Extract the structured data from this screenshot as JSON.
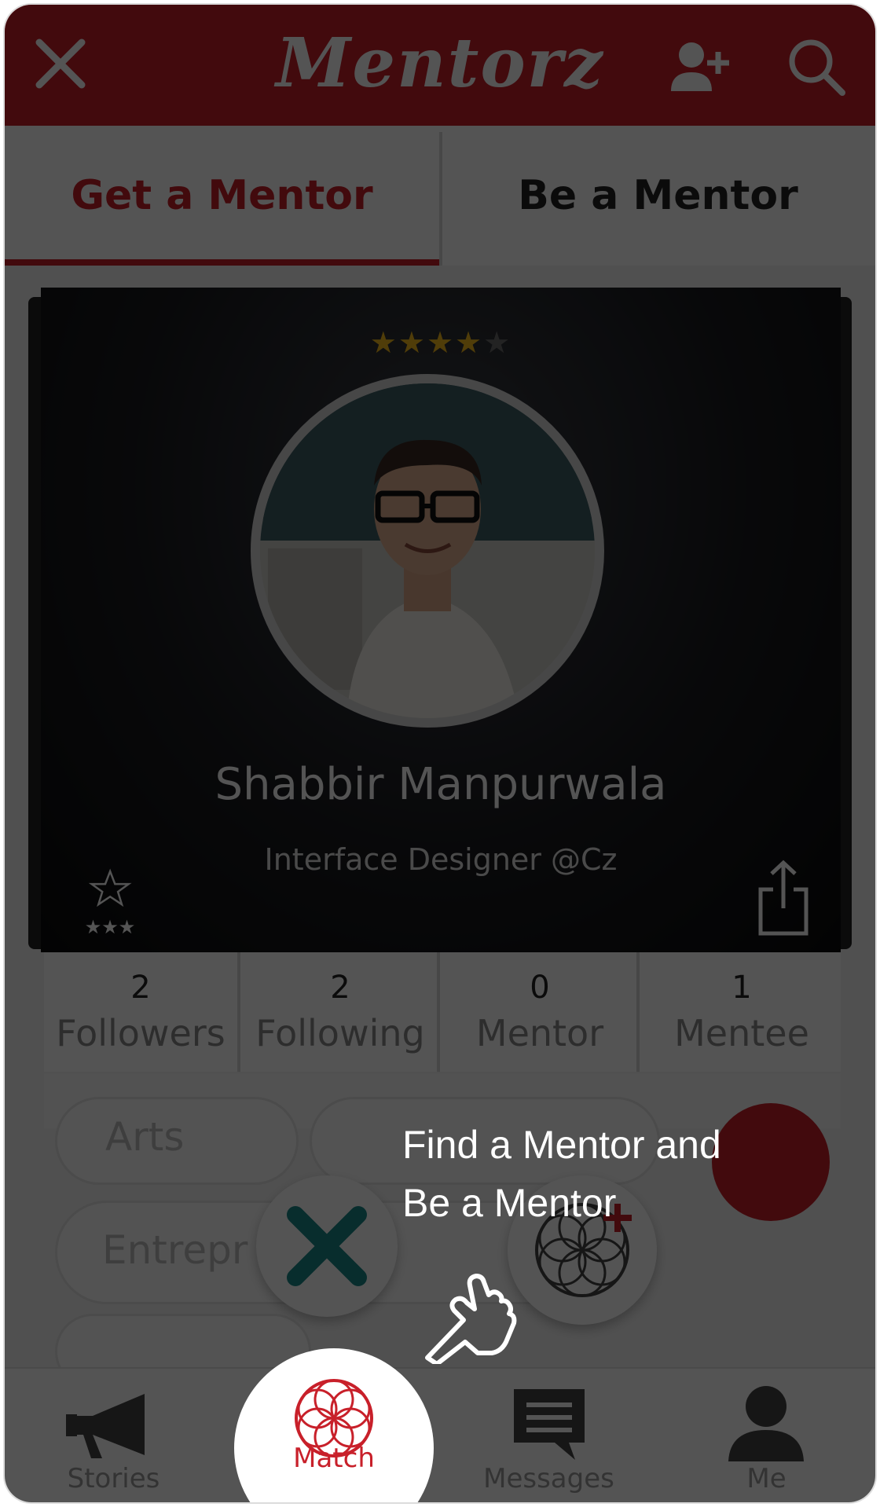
{
  "header": {
    "logo_text": "Mentorz",
    "close_icon": "close-icon",
    "add_user_icon": "add-user-icon",
    "search_icon": "search-icon"
  },
  "tabs": [
    {
      "label": "Get a Mentor",
      "active": true
    },
    {
      "label": "Be a Mentor",
      "active": false
    }
  ],
  "profile_card": {
    "rating": {
      "filled": 4,
      "total": 5
    },
    "name": "Shabbir Manpurwala",
    "title": "Interface Designer @Cz",
    "stats": [
      {
        "count": "2",
        "label": "Followers"
      },
      {
        "count": "2",
        "label": "Following"
      },
      {
        "count": "0",
        "label": "Mentor"
      },
      {
        "count": "1",
        "label": "Mentee"
      }
    ]
  },
  "background_chips": [
    {
      "label": "Arts"
    },
    {
      "label": "Entrepr"
    }
  ],
  "tutorial": {
    "hint_line1": "Find a Mentor and",
    "hint_line2": "Be a Mentor"
  },
  "bottom_nav": [
    {
      "label": "Stories",
      "icon": "megaphone-icon",
      "active": false
    },
    {
      "label": "Match",
      "icon": "flower-of-life-icon",
      "active": true
    },
    {
      "label": "Messages",
      "icon": "chat-icon",
      "active": false
    },
    {
      "label": "Me",
      "icon": "person-icon",
      "active": false
    }
  ],
  "colors": {
    "brand_red": "#c8202a",
    "star_gold": "#f2b81c",
    "reject_teal": "#1a8a8a"
  }
}
